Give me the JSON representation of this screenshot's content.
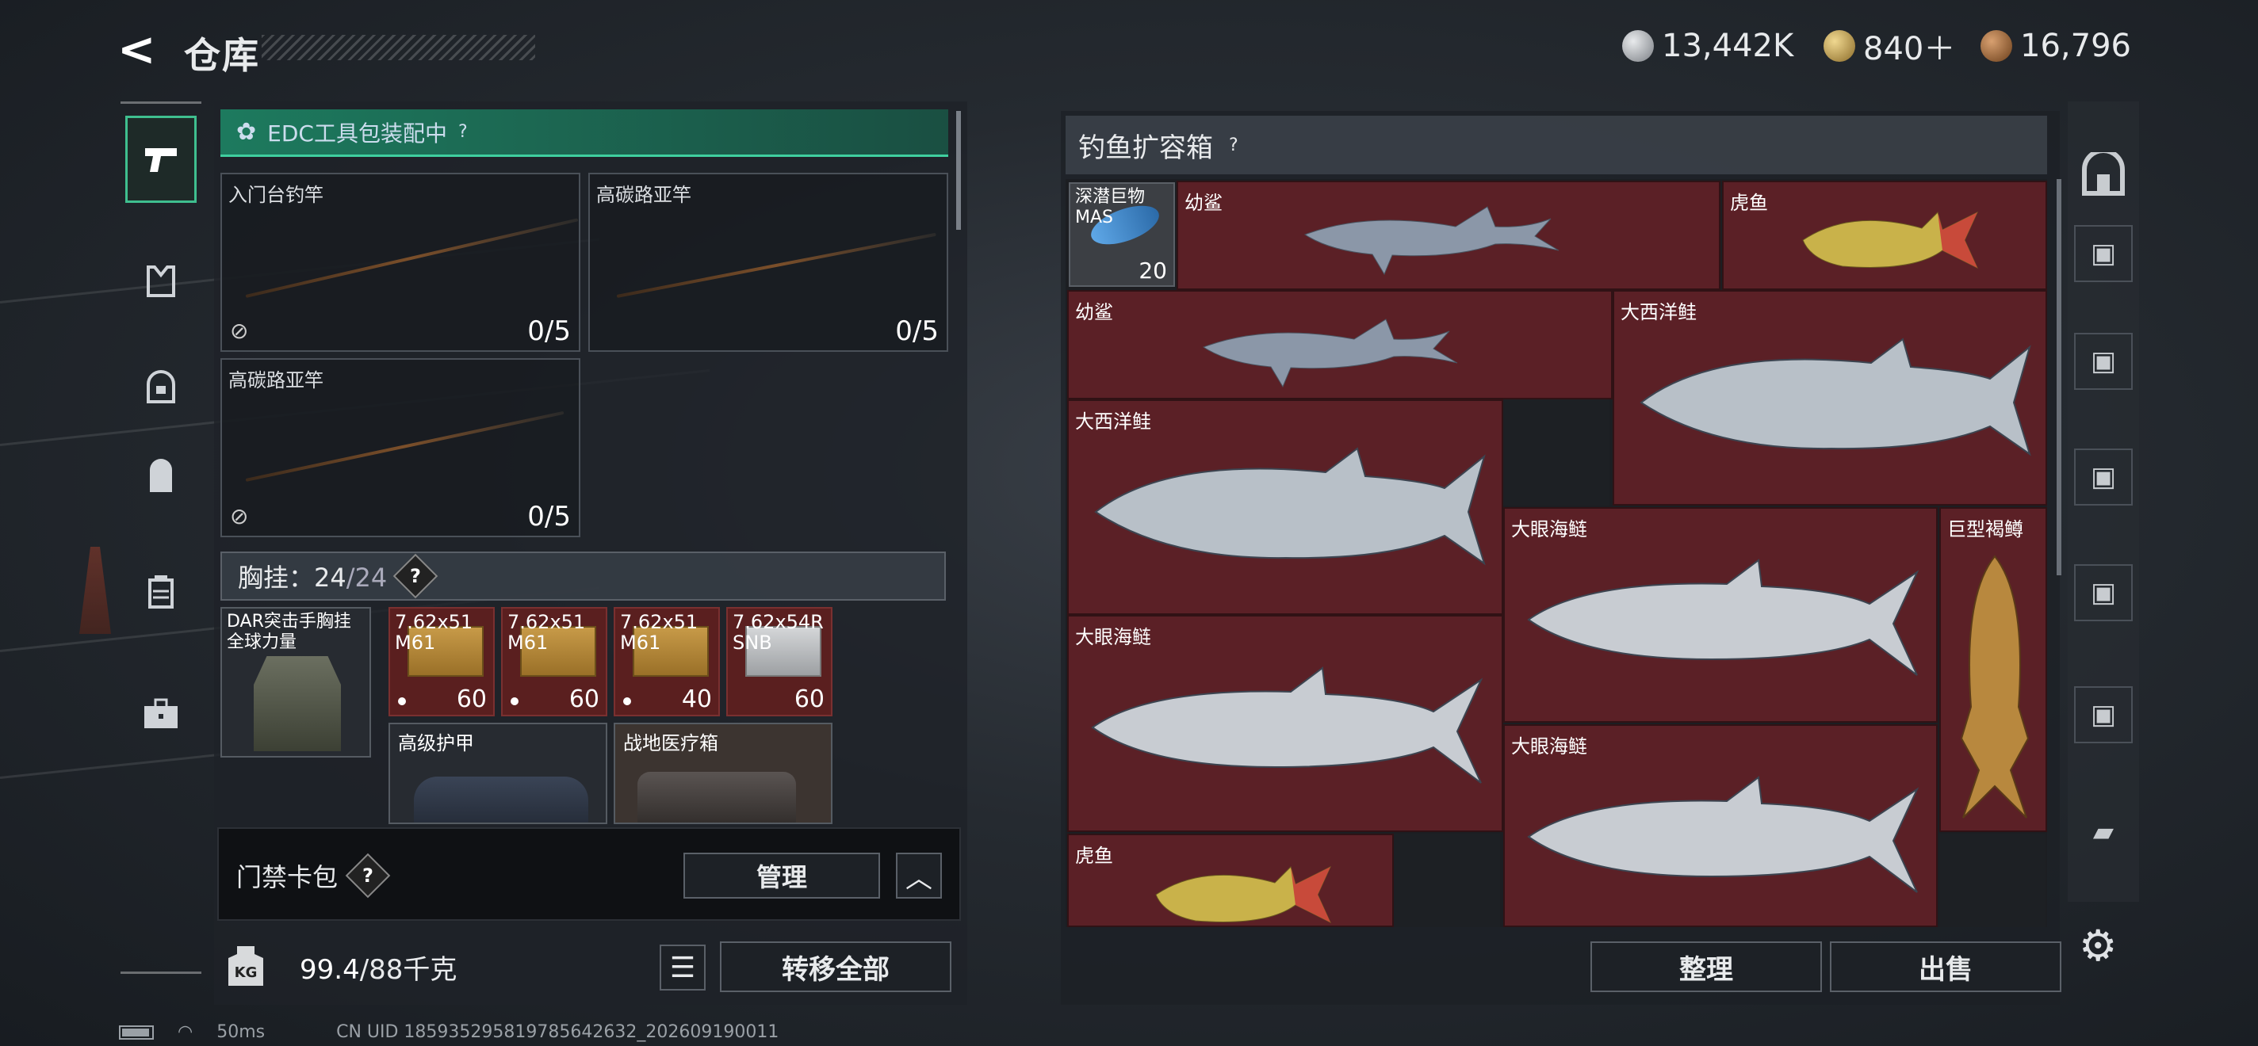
{
  "header": {
    "back_label": "<",
    "title": "仓库",
    "currencies": [
      {
        "value": "13,442K",
        "color": "#b8bcc2"
      },
      {
        "value": "840＋",
        "color": "#c9a85a"
      },
      {
        "value": "16,796",
        "color": "#a8703a"
      }
    ]
  },
  "nav": {
    "items": [
      {
        "icon": "pistol-icon"
      },
      {
        "icon": "armor-icon"
      },
      {
        "icon": "helmet-icon"
      },
      {
        "icon": "backpack-icon"
      },
      {
        "icon": "vest-icon"
      },
      {
        "icon": "toolbox-icon"
      }
    ]
  },
  "left": {
    "edc_label": "EDC工具包装配中",
    "rods": [
      {
        "name": "入门台钓竿",
        "count": "0/5"
      },
      {
        "name": "高碳路亚竿",
        "count": "0/5"
      },
      {
        "name": "高碳路亚竿",
        "count": "0/5"
      }
    ],
    "vest_label": "胸挂：",
    "vest_count": "24",
    "vest_max": "/24",
    "vest_item_name": "DAR突击手胸挂 全球力量",
    "ammo": [
      {
        "name": "7.62x51 M61",
        "count": "60",
        "type": "gold"
      },
      {
        "name": "7.62x51 M61",
        "count": "60",
        "type": "gold"
      },
      {
        "name": "7.62x51 M61",
        "count": "40",
        "type": "gold"
      },
      {
        "name": "7.62x54R SNB",
        "count": "60",
        "type": "silver"
      }
    ],
    "big_items": [
      {
        "name": "高级护甲"
      },
      {
        "name": "战地医疗箱"
      }
    ],
    "keycard_label": "门禁卡包",
    "manage_label": "管理",
    "weight_icon_text": "KG",
    "weight_current": "99.4",
    "weight_max": "/88千克",
    "transfer_label": "转移全部"
  },
  "right": {
    "title": "钓鱼扩容箱",
    "lure": {
      "name": "深潜巨物 MAS",
      "count": "20"
    },
    "fish": [
      {
        "name": "幼鲨",
        "kind": "shark"
      },
      {
        "name": "虎鱼",
        "kind": "tiger"
      },
      {
        "name": "幼鲨",
        "kind": "shark"
      },
      {
        "name": "大西洋鲑",
        "kind": "salmon"
      },
      {
        "name": "大西洋鲑",
        "kind": "salmon"
      },
      {
        "name": "大眼海鲢",
        "kind": "tarpon"
      },
      {
        "name": "巨型褐鳟",
        "kind": "trout"
      },
      {
        "name": "大眼海鲢",
        "kind": "tarpon"
      },
      {
        "name": "大眼海鲢",
        "kind": "tarpon"
      },
      {
        "name": "虎鱼",
        "kind": "tiger"
      }
    ],
    "sort_label": "整理",
    "sell_label": "出售"
  },
  "status": {
    "ping": "50ms",
    "uid": "CN UID 18593529581978564263​2_202609190011"
  }
}
